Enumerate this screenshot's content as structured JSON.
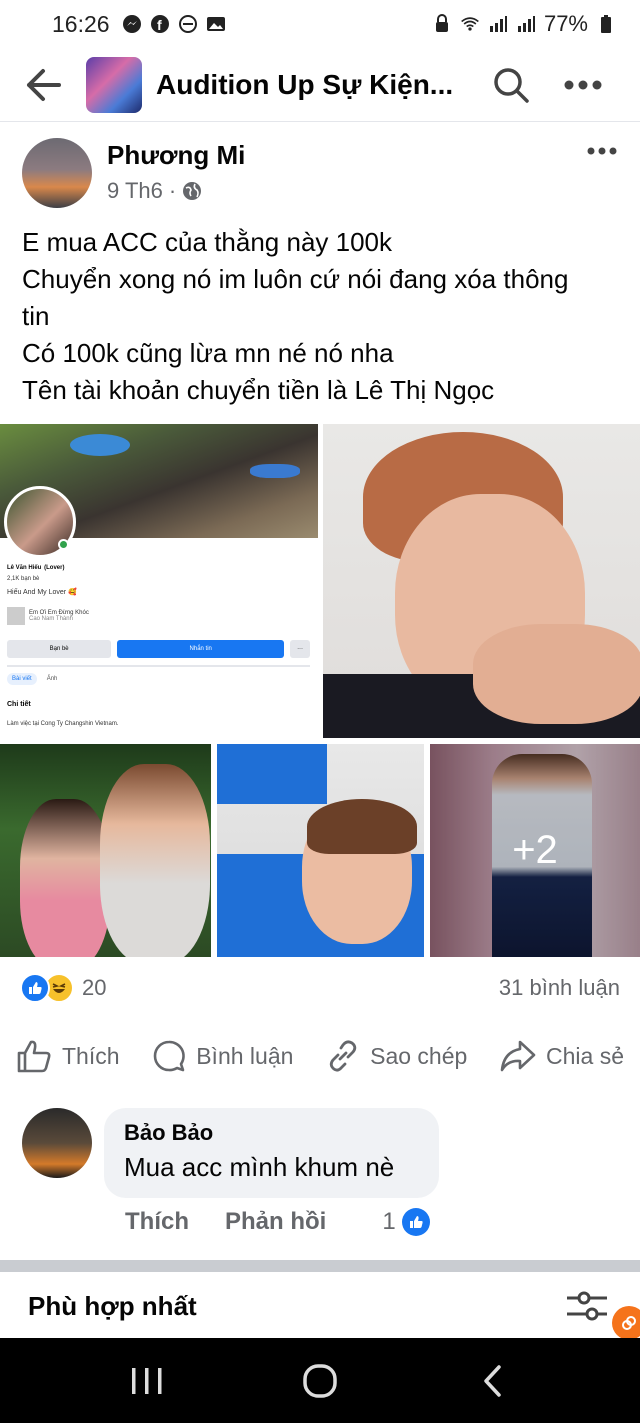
{
  "status_bar": {
    "time": "16:26",
    "battery": "77%"
  },
  "header": {
    "title": "Audition Up Sự Kiện..."
  },
  "post": {
    "author": "Phương Mi",
    "date": "9 Th6",
    "separator": "·",
    "lines": [
      "E mua ACC của thằng này 100k",
      "Chuyển xong nó im luôn cứ nói đang xóa thông",
      "tin",
      "Có 100k cũng lừa mn né nó nha",
      "Tên tài khoản chuyển tiền là Lê Thị Ngọc"
    ],
    "photo_profile": {
      "name": "Lê Văn Hiếu",
      "name_tag": "(Lover)",
      "friends": "2,1K bạn bè",
      "bio": "Hiếu And My Lover 🥰",
      "song": "Em Ơi Em Đừng Khóc",
      "song_artist": "Cao Nam Thành",
      "btn_friends": "Bạn bè",
      "btn_message": "Nhắn tin",
      "btn_more": "···",
      "tab_posts": "Bài viết",
      "tab_photos": "Ảnh",
      "details_title": "Chi tiết",
      "work": "Làm việc tại Cong Ty Changshin Vietnam."
    },
    "more_photos": "+2",
    "reaction_count": "20",
    "comment_count": "31 bình luận",
    "actions": {
      "like": "Thích",
      "comment": "Bình luận",
      "copy": "Sao chép",
      "share": "Chia sẻ"
    }
  },
  "comment": {
    "author": "Bảo Bảo",
    "text": "Mua acc mình khum nè",
    "like": "Thích",
    "reply": "Phản hồi",
    "reaction_count": "1"
  },
  "sort": {
    "label": "Phù hợp nhất"
  },
  "colors": {
    "brand_blue": "#1877f2",
    "secondary_text": "#65676b"
  }
}
